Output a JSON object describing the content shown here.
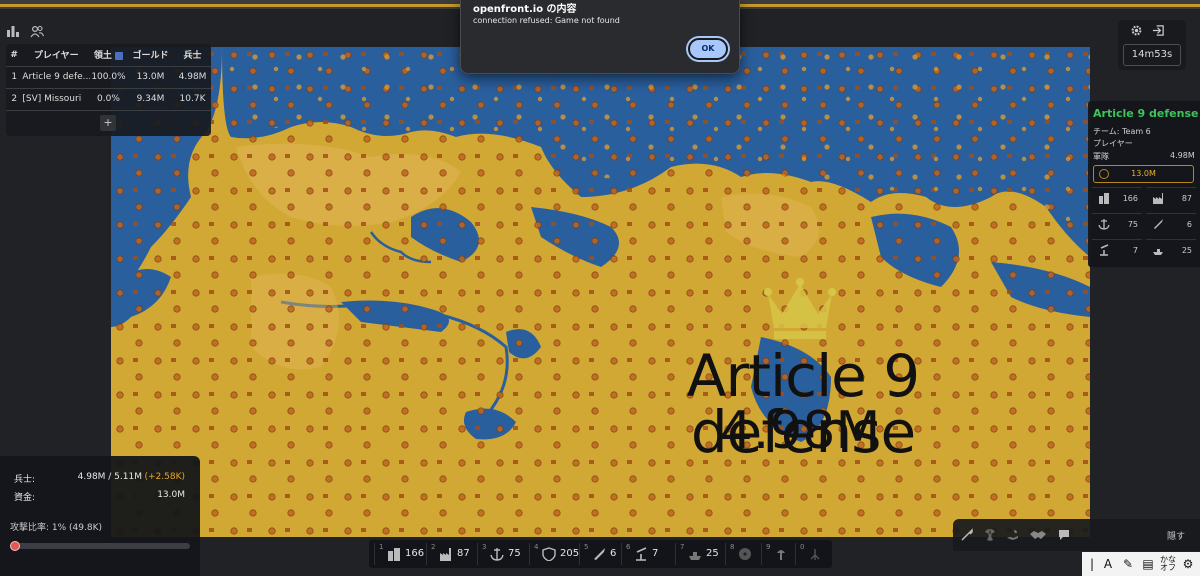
{
  "dialog": {
    "title": "openfront.io の内容",
    "message": "connection refused: Game not found",
    "ok_label": "OK"
  },
  "leaderboard": {
    "headers": [
      "#",
      "プレイヤー",
      "領土",
      "ゴールド",
      "兵士"
    ],
    "rows": [
      {
        "rank": "1",
        "name": "Article 9 defe...",
        "territory": "100.0%",
        "gold": "13.0M",
        "troops": "4.98M"
      },
      {
        "rank": "2",
        "name": "[SV] Missouri",
        "territory": "0.0%",
        "gold": "9.34M",
        "troops": "10.7K"
      }
    ],
    "add_label": "+"
  },
  "timer": "14m53s",
  "player": {
    "name": "Article 9 defense",
    "team": "チーム: Team 6",
    "type": "プレイヤー",
    "army_label": "軍隊",
    "army_value": "4.98M",
    "gold": "13.0M",
    "cities": "166",
    "factories": "87",
    "ports": "75",
    "missiles": "6",
    "sams": "7",
    "warships": "25"
  },
  "map_overlay": {
    "name": "Article 9 defense",
    "troops": "4.98M"
  },
  "stats": {
    "troops_label": "兵士:",
    "troops_value": "4.98M / 5.11M",
    "troops_gain": "(+2.58K)",
    "gold_label": "資金:",
    "gold_value": "13.0M",
    "attack_label": "攻撃比率: 1% (49.8K)",
    "attack_ratio": 0.01
  },
  "build_bar": [
    {
      "key": "1",
      "icon": "city-icon",
      "count": "166"
    },
    {
      "key": "2",
      "icon": "factory-icon",
      "count": "87"
    },
    {
      "key": "3",
      "icon": "port-icon",
      "count": "75"
    },
    {
      "key": "4",
      "icon": "defense-post-icon",
      "count": "205"
    },
    {
      "key": "5",
      "icon": "missile-silo-icon",
      "count": "6"
    },
    {
      "key": "6",
      "icon": "sam-launcher-icon",
      "count": "7"
    },
    {
      "key": "7",
      "icon": "warship-icon",
      "count": "25"
    },
    {
      "key": "8",
      "icon": "atom-bomb-icon",
      "count": ""
    },
    {
      "key": "9",
      "icon": "hydrogen-bomb-icon",
      "count": ""
    },
    {
      "key": "0",
      "icon": "mirv-icon",
      "count": ""
    }
  ],
  "action_bar": {
    "hide_label": "隠す"
  },
  "colors": {
    "land": "#c9a437",
    "water": "#2a5f9e",
    "territory": "#e0a534",
    "player_name": "#3ec45a",
    "gold": "#e6b22f"
  }
}
